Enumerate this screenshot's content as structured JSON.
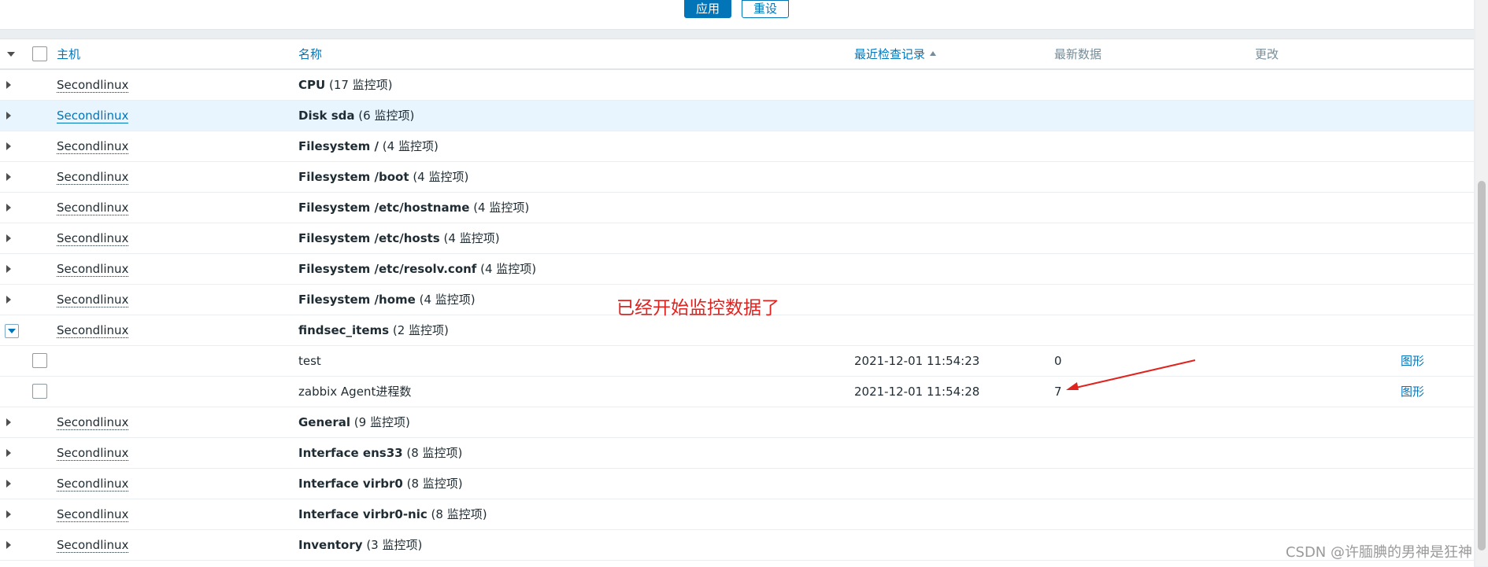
{
  "filter": {
    "apply_label": "应用",
    "reset_label": "重设"
  },
  "header": {
    "host": "主机",
    "name": "名称",
    "last_check": "最近检查记录",
    "latest_data": "最新数据",
    "change": "更改"
  },
  "rows": [
    {
      "host": "Secondlinux",
      "name": "CPU",
      "count": "(17 监控项)"
    },
    {
      "host": "Secondlinux",
      "name": "Disk sda",
      "count": "(6 监控项)"
    },
    {
      "host": "Secondlinux",
      "name": "Filesystem /",
      "count": "(4 监控项)"
    },
    {
      "host": "Secondlinux",
      "name": "Filesystem /boot",
      "count": "(4 监控项)"
    },
    {
      "host": "Secondlinux",
      "name": "Filesystem /etc/hostname",
      "count": "(4 监控项)"
    },
    {
      "host": "Secondlinux",
      "name": "Filesystem /etc/hosts",
      "count": "(4 监控项)"
    },
    {
      "host": "Secondlinux",
      "name": "Filesystem /etc/resolv.conf",
      "count": "(4 监控项)"
    },
    {
      "host": "Secondlinux",
      "name": "Filesystem /home",
      "count": "(4 监控项)"
    },
    {
      "host": "Secondlinux",
      "name": "findsec_items",
      "count": "(2 监控项)"
    },
    {
      "item": "test",
      "last_check": "2021-12-01 11:54:23",
      "value": "0",
      "graph": "图形"
    },
    {
      "item": "zabbix Agent进程数",
      "last_check": "2021-12-01 11:54:28",
      "value": "7",
      "graph": "图形"
    },
    {
      "host": "Secondlinux",
      "name": "General",
      "count": "(9 监控项)"
    },
    {
      "host": "Secondlinux",
      "name": "Interface ens33",
      "count": "(8 监控项)"
    },
    {
      "host": "Secondlinux",
      "name": "Interface virbr0",
      "count": "(8 监控项)"
    },
    {
      "host": "Secondlinux",
      "name": "Interface virbr0-nic",
      "count": "(8 监控项)"
    },
    {
      "host": "Secondlinux",
      "name": "Inventory",
      "count": "(3 监控项)"
    }
  ],
  "annotation": "已经开始监控数据了",
  "watermark": "CSDN @许腼腆的男神是狂神",
  "colors": {
    "link": "#0275b8",
    "annotation": "#e0231f",
    "hover_row": "#e8f5ff"
  }
}
